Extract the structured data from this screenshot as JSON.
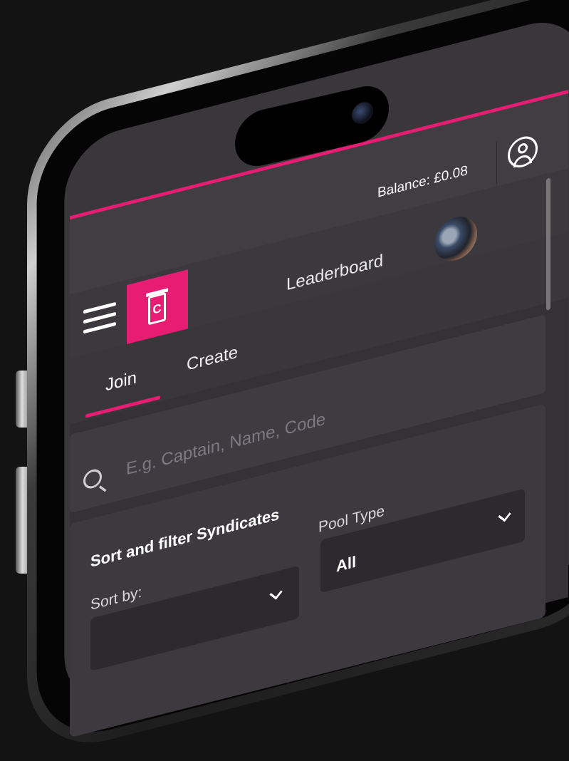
{
  "header": {
    "balance_text": "Balance: £0.08",
    "account_icon": "account-circle-icon",
    "accent_color": "#e71d73"
  },
  "nav": {
    "menu_icon": "hamburger-menu-icon",
    "logo_letter": "C",
    "leaderboard_label": "Leaderboard"
  },
  "tabs": [
    {
      "label": "Join",
      "active": true
    },
    {
      "label": "Create",
      "active": false
    }
  ],
  "search": {
    "placeholder": "E.g. Captain, Name, Code",
    "value": ""
  },
  "filters": {
    "title": "Sort and filter Syndicates",
    "pool_type_label": "Pool Type",
    "pool_type_value": "All",
    "sort_by_label": "Sort by:",
    "sort_by_value": ""
  }
}
